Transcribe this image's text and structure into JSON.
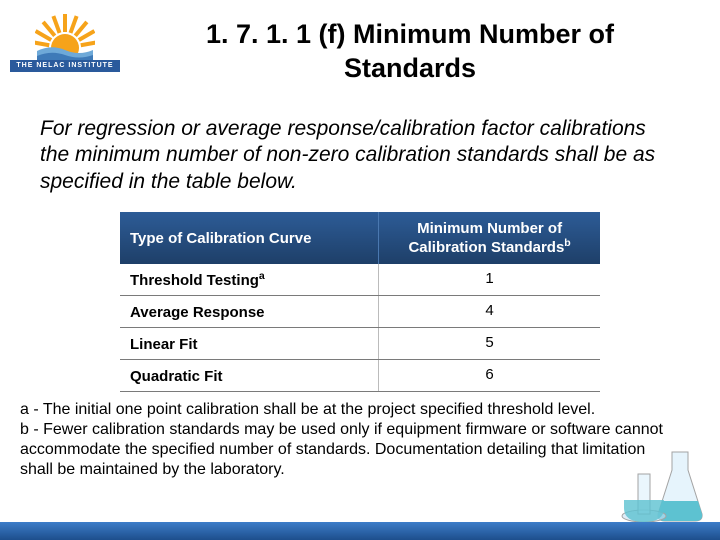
{
  "logo": {
    "bar_text": "THE NELAC INSTITUTE"
  },
  "title": "1. 7. 1. 1 (f) Minimum Number of Standards",
  "body": "For regression or average response/calibration factor calibrations the minimum number of non-zero calibration standards shall be as specified in the table below.",
  "table": {
    "headers": {
      "col1": "Type of Calibration Curve",
      "col2_pre": "Minimum Number of Calibration Standards",
      "col2_sup": "b"
    },
    "rows": [
      {
        "label": "Threshold Testing",
        "sup": "a",
        "value": "1"
      },
      {
        "label": "Average Response",
        "sup": "",
        "value": "4"
      },
      {
        "label": "Linear Fit",
        "sup": "",
        "value": "5"
      },
      {
        "label": "Quadratic Fit",
        "sup": "",
        "value": "6"
      }
    ]
  },
  "footnotes": {
    "a": "a - The initial one point calibration shall be at the project specified threshold level.",
    "b": "b - Fewer calibration standards may be used only if equipment firmware or software cannot accommodate the specified number of standards. Documentation detailing that limitation shall be maintained by the laboratory."
  }
}
